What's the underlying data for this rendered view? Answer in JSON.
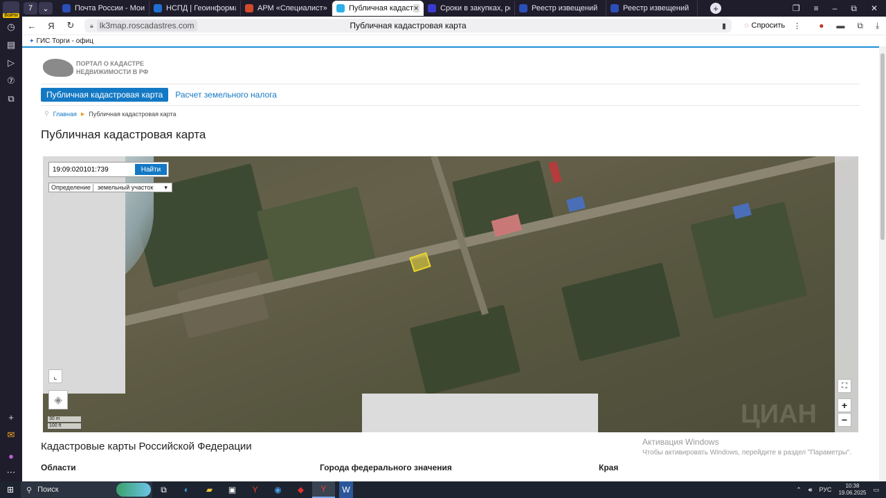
{
  "sidebar": {
    "avatar_label": "Войти",
    "icons": [
      "clock-icon",
      "notes-icon",
      "play-icon",
      "seven-icon",
      "screen-icon"
    ]
  },
  "tabs": [
    {
      "label": "Почта России - Мои отпр",
      "color": "#2a4fb8"
    },
    {
      "label": "НСПД | Геоинформацион",
      "color": "#1f6fd1"
    },
    {
      "label": "АРМ «Специалист»",
      "color": "#d14a2a"
    },
    {
      "label": "Публичная кадастрова",
      "color": "#2bb1e8",
      "active": true
    },
    {
      "label": "Сроки в закупках, регул",
      "color": "#3a3ad1"
    },
    {
      "label": "Реестр извещений",
      "color": "#2a4fb8"
    },
    {
      "label": "Реестр извещений",
      "color": "#2a4fb8"
    }
  ],
  "tab_counter": "7",
  "addressbar": {
    "url": "lk3map.roscadastres.com",
    "page_title": "Публичная кадастровая карта",
    "ask_label": "Спросить"
  },
  "bookmarks": [
    {
      "label": "ГИС Торги - офиц"
    }
  ],
  "site": {
    "logo_line1": "ПОРТАЛ О КАДАСТРЕ",
    "logo_line2": "НЕДВИЖИМОСТИ В РФ",
    "nav_active": "Публичная кадастровая карта",
    "nav_link": "Расчет земельного налога",
    "breadcrumb_home": "Главная",
    "breadcrumb_current": "Публичная кадастровая карта",
    "heading": "Публичная кадастровая карта"
  },
  "map": {
    "search_value": "19:09:020101:739",
    "find_label": "Найти",
    "definition_label": "Определение",
    "definition_value": "земельный участок",
    "zoom_in": "+",
    "zoom_out": "−",
    "scale_m": "30 m",
    "scale_ft": "100 ft",
    "watermark": "ЦИАН"
  },
  "sections": {
    "heading": "Кадастровые карты Российской Федерации",
    "col1": "Области",
    "col2": "Города федерального значения",
    "col3": "Края"
  },
  "activation": {
    "title": "Активация Windows",
    "subtitle": "Чтобы активировать Windows, перейдите в раздел \"Параметры\"."
  },
  "taskbar": {
    "search_label": "Поиск",
    "lang": "РУС",
    "time": "10:38",
    "date": "19.06.2025"
  }
}
